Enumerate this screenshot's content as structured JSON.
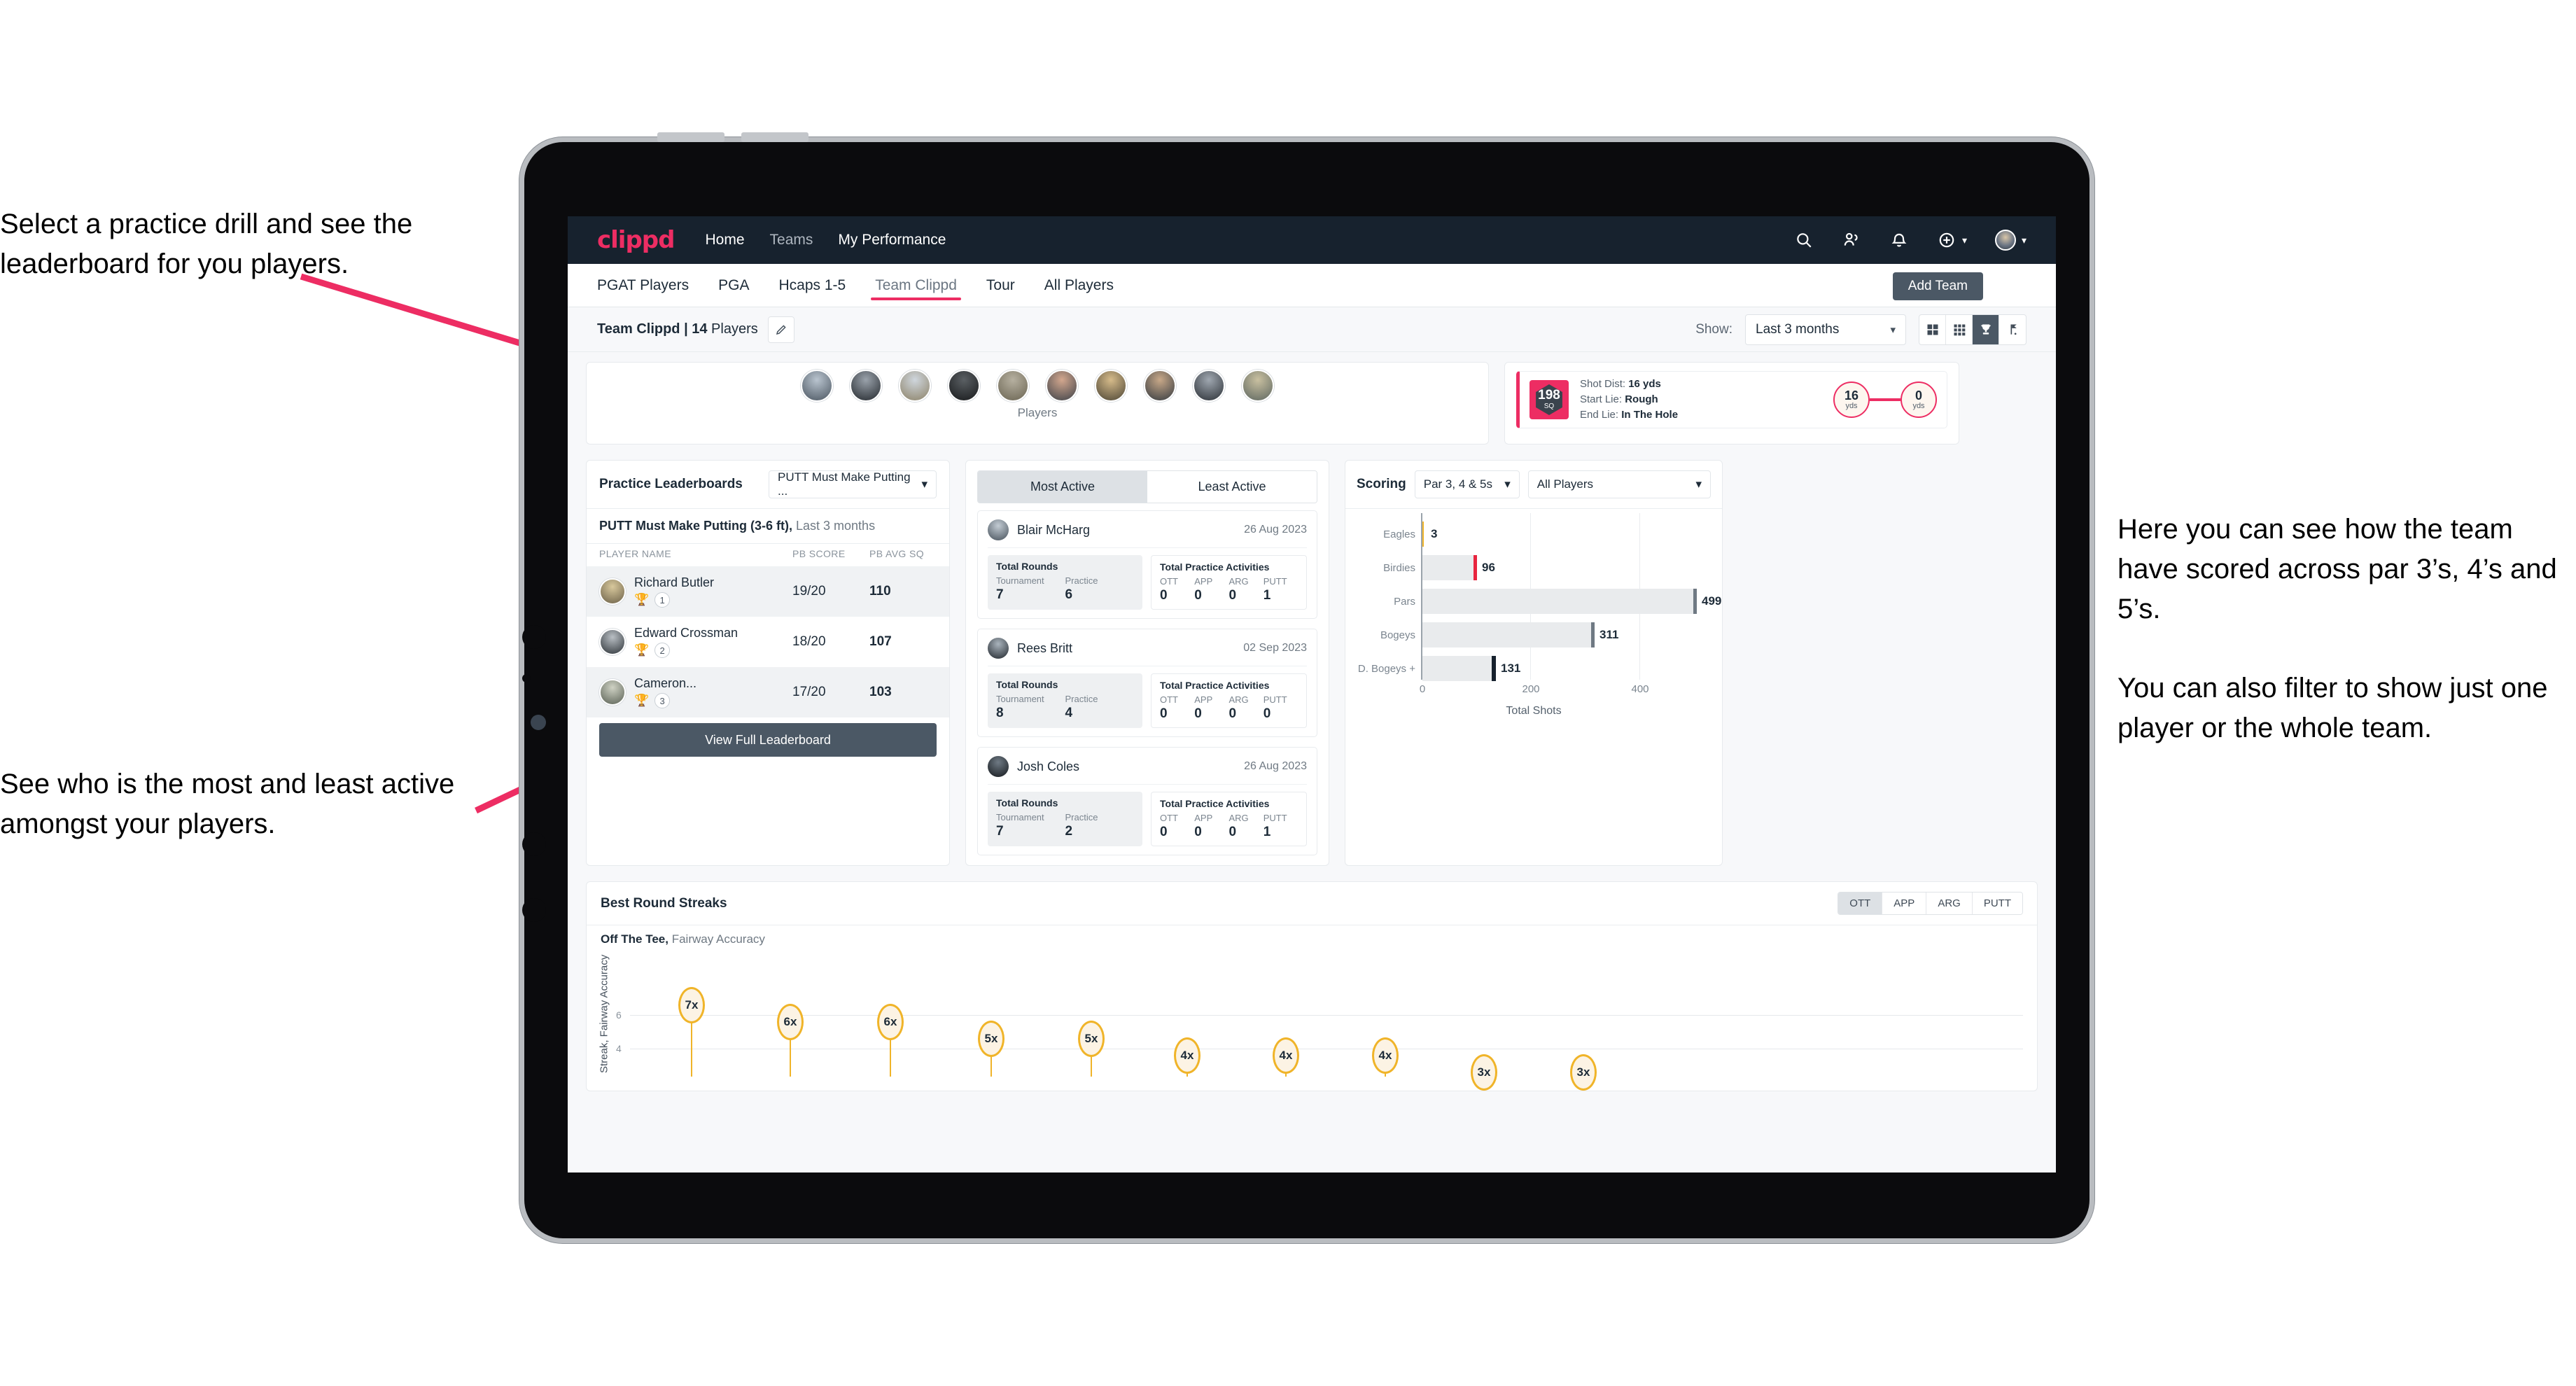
{
  "annotations": {
    "left_top": "Select a practice drill and see the leaderboard for you players.",
    "left_bottom": "See who is the most and least active amongst your players.",
    "right": "Here you can see how the team have scored across par 3’s, 4’s and 5’s.\n\nYou can also filter to show just one player or the whole team."
  },
  "colors": {
    "brand_pink": "#ed2d63",
    "header_dark": "#17222e",
    "button_slate": "#4b5865",
    "gold": "#f0b429"
  },
  "appbar": {
    "logo": "clippd",
    "nav": [
      {
        "label": "Home",
        "active": true
      },
      {
        "label": "Teams",
        "active": false
      },
      {
        "label": "My Performance",
        "active": true
      }
    ],
    "icons": [
      "search-icon",
      "people-icon",
      "bell-icon",
      "plus-circle-icon",
      "avatar"
    ]
  },
  "tabs": {
    "items": [
      "PGAT Players",
      "PGA",
      "Hcaps 1-5",
      "Team Clippd",
      "Tour",
      "All Players"
    ],
    "active": "Team Clippd",
    "add_team_label": "Add Team"
  },
  "filters": {
    "team_title_bold": "Team Clippd | 14",
    "team_title_rest": " Players",
    "edit_icon": "pencil-icon",
    "show_label": "Show:",
    "range_value": "Last 3 months",
    "view_buttons": [
      {
        "icon": "grid-4-icon",
        "active": false
      },
      {
        "icon": "grid-9-icon",
        "active": false
      },
      {
        "icon": "trophy-icon",
        "active": true
      },
      {
        "icon": "golf-flag-icon",
        "active": false
      }
    ]
  },
  "players_strip": {
    "label": "Players",
    "count": 10
  },
  "shot_card": {
    "sq_value": "198",
    "sq_unit": "SQ",
    "lines": [
      {
        "label": "Shot Dist:",
        "value": "16 yds"
      },
      {
        "label": "Start Lie:",
        "value": "Rough"
      },
      {
        "label": "End Lie:",
        "value": "In The Hole"
      }
    ],
    "start_dist": "16",
    "start_unit": "yds",
    "end_dist": "0",
    "end_unit": "yds"
  },
  "leaderboard": {
    "title": "Practice Leaderboards",
    "drill_select": "PUTT Must Make Putting ...",
    "subtitle_bold": "PUTT Must Make Putting (3-6 ft),",
    "subtitle_rest": " Last 3 months",
    "columns": [
      "PLAYER NAME",
      "PB SCORE",
      "PB AVG SQ"
    ],
    "rows": [
      {
        "name": "Richard Butler",
        "rank": "1",
        "trophy": "gold",
        "pb_score": "19/20",
        "pb_avg_sq": "110"
      },
      {
        "name": "Edward Crossman",
        "rank": "2",
        "trophy": "silver",
        "pb_score": "18/20",
        "pb_avg_sq": "107"
      },
      {
        "name": "Cameron...",
        "rank": "3",
        "trophy": "bronze",
        "pb_score": "17/20",
        "pb_avg_sq": "103"
      }
    ],
    "view_full_label": "View Full Leaderboard"
  },
  "activity": {
    "tabs": [
      {
        "label": "Most Active",
        "active": true
      },
      {
        "label": "Least Active",
        "active": false
      }
    ],
    "rounds_title": "Total Rounds",
    "rounds_cols": [
      "Tournament",
      "Practice"
    ],
    "practice_title": "Total Practice Activities",
    "practice_cols": [
      "OTT",
      "APP",
      "ARG",
      "PUTT"
    ],
    "players": [
      {
        "name": "Blair McHarg",
        "date": "26 Aug 2023",
        "tournament": "7",
        "practice": "6",
        "ott": "0",
        "app": "0",
        "arg": "0",
        "putt": "1"
      },
      {
        "name": "Rees Britt",
        "date": "02 Sep 2023",
        "tournament": "8",
        "practice": "4",
        "ott": "0",
        "app": "0",
        "arg": "0",
        "putt": "0"
      },
      {
        "name": "Josh Coles",
        "date": "26 Aug 2023",
        "tournament": "7",
        "practice": "2",
        "ott": "0",
        "app": "0",
        "arg": "0",
        "putt": "1"
      }
    ]
  },
  "scoring": {
    "title": "Scoring",
    "par_select": "Par 3, 4 & 5s",
    "player_select": "All Players"
  },
  "streaks": {
    "title": "Best Round Streaks",
    "segments": [
      {
        "label": "OTT",
        "active": true
      },
      {
        "label": "APP",
        "active": false
      },
      {
        "label": "ARG",
        "active": false
      },
      {
        "label": "PUTT",
        "active": false
      }
    ],
    "subtitle_bold": "Off The Tee,",
    "subtitle_rest": " Fairway Accuracy"
  },
  "chart_data": [
    {
      "type": "bar",
      "orientation": "horizontal",
      "title": "Scoring",
      "categories": [
        "Eagles",
        "Birdies",
        "Pars",
        "Bogeys",
        "D. Bogeys +"
      ],
      "values": [
        3,
        96,
        499,
        311,
        131
      ],
      "cap_colors": [
        "#f0b429",
        "#e8253f",
        "#6f7983",
        "#6f7983",
        "#17222e"
      ],
      "xlabel": "Total Shots",
      "ylabel": "",
      "xticks": [
        0,
        200,
        400
      ],
      "xlim": [
        0,
        560
      ],
      "grid": true,
      "legend": false
    },
    {
      "type": "bar",
      "subtype": "lollipop",
      "title": "Best Round Streaks",
      "series_label": "Off The Tee, Fairway Accuracy",
      "ylabel": "Streak, Fairway Accuracy",
      "yticks": [
        4,
        6
      ],
      "ylim": [
        0,
        7.8
      ],
      "values": [
        7,
        6,
        6,
        5,
        5,
        4,
        4,
        4,
        3,
        3
      ],
      "labels": [
        "7x",
        "6x",
        "6x",
        "5x",
        "5x",
        "4x",
        "4x",
        "4x",
        "3x",
        "3x"
      ],
      "grid": true,
      "legend": false
    }
  ]
}
